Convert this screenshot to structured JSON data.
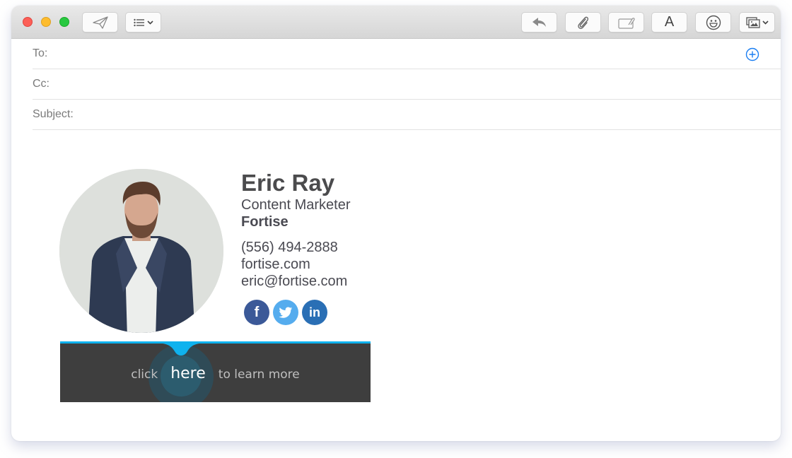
{
  "window": {
    "traffic_lights": [
      {
        "name": "close",
        "color": "#fc5f57"
      },
      {
        "name": "minimize",
        "color": "#fdbc2e"
      },
      {
        "name": "maximize",
        "color": "#28c840"
      }
    ]
  },
  "toolbar": {
    "left_buttons": [
      {
        "icon": "send-icon",
        "label": "Send"
      },
      {
        "icon": "list-format-icon",
        "label": "Header fields",
        "has_dropdown": true
      }
    ],
    "right_buttons": [
      {
        "icon": "reply-icon",
        "label": "Reply"
      },
      {
        "icon": "paperclip-icon",
        "label": "Attach"
      },
      {
        "icon": "markup-icon",
        "label": "Markup"
      },
      {
        "icon": "font-icon",
        "label": "A"
      },
      {
        "icon": "emoji-icon",
        "label": "Emoji"
      },
      {
        "icon": "photo-browser-icon",
        "label": "Photos",
        "has_dropdown": true
      }
    ]
  },
  "fields": {
    "to": {
      "label": "To:",
      "value": ""
    },
    "cc": {
      "label": "Cc:",
      "value": ""
    },
    "subject": {
      "label": "Subject:",
      "value": ""
    },
    "add_contact_icon": "plus-circle-icon",
    "accent": "#1a7ef2"
  },
  "signature": {
    "name": "Eric Ray",
    "title": "Content Marketer",
    "company": "Fortise",
    "phone": "(556) 494-2888",
    "website": "fortise.com",
    "email": "eric@fortise.com",
    "social": [
      {
        "network": "facebook",
        "glyph": "f",
        "color": "#3b5998"
      },
      {
        "network": "twitter",
        "glyph": "twitter-bird",
        "color": "#55acee"
      },
      {
        "network": "linkedin",
        "glyph": "in",
        "color": "#2a6fb5"
      }
    ]
  },
  "banner": {
    "prefix": "click",
    "link": "here",
    "suffix": "to learn more",
    "accent": "#0fb2ee",
    "background": "#3e3e3e"
  }
}
